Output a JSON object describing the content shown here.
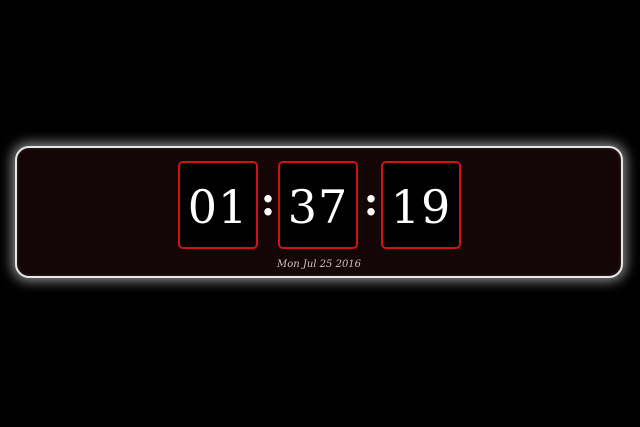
{
  "clock": {
    "hours": "01",
    "minutes": "37",
    "seconds": "19",
    "separator": ":",
    "date": "Mon Jul 25 2016"
  },
  "colors": {
    "background": "#000000",
    "panel": "#140606",
    "panel_border": "#e8e8e8",
    "digit_border": "#d31212",
    "digit_text": "#ffffff",
    "date_text": "#c9c2c2"
  }
}
